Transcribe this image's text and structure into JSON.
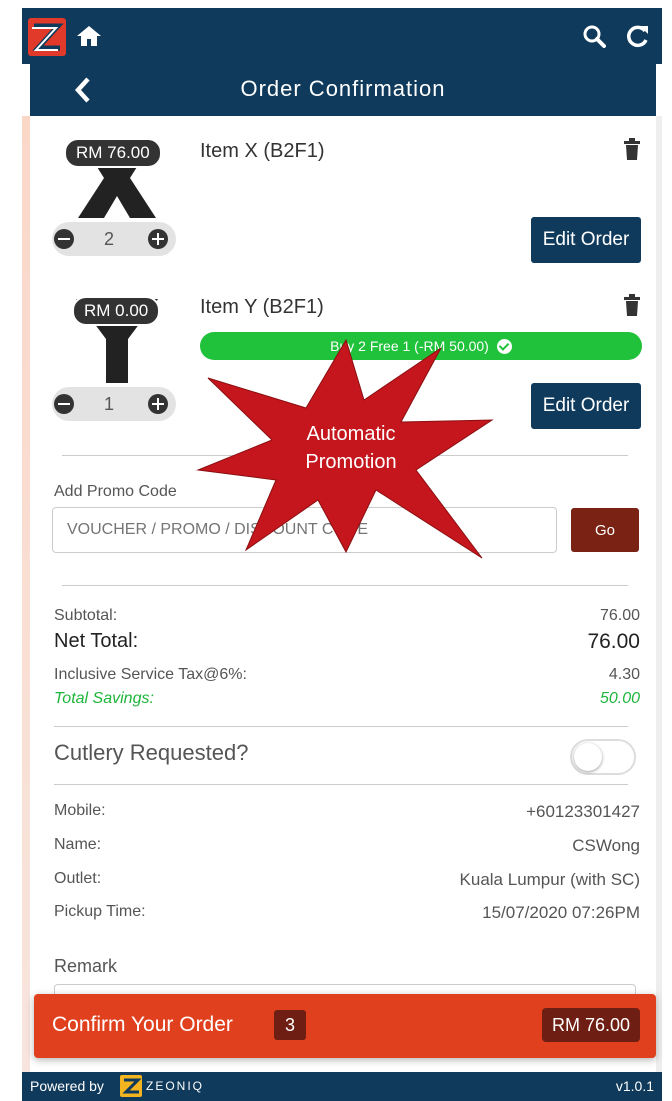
{
  "app": {
    "title": "Order Confirmation"
  },
  "items": [
    {
      "name": "Item X (B2F1)",
      "price": "RM 76.00",
      "qty": "2",
      "edit_label": "Edit Order",
      "image_letter": "X"
    },
    {
      "name": "Item Y (B2F1)",
      "price": "RM 0.00",
      "qty": "1",
      "edit_label": "Edit Order",
      "image_letter": "Y",
      "promo": "Buy 2 Free 1 (-RM 50.00)"
    }
  ],
  "promo": {
    "label": "Add Promo Code",
    "placeholder": "VOUCHER / PROMO / DISCOUNT CODE",
    "go_label": "Go"
  },
  "annotation": {
    "line1": "Automatic",
    "line2": "Promotion"
  },
  "summary": {
    "subtotal_label": "Subtotal:",
    "subtotal": "76.00",
    "net_label": "Net Total:",
    "net": "76.00",
    "tax_label": "Inclusive Service Tax@6%:",
    "tax": "4.30",
    "savings_label": "Total Savings:",
    "savings": "50.00"
  },
  "cutlery": {
    "label": "Cutlery Requested?",
    "enabled": false
  },
  "details": {
    "mobile_label": "Mobile:",
    "mobile": "+60123301427",
    "name_label": "Name:",
    "name": "CSWong",
    "outlet_label": "Outlet:",
    "outlet": "Kuala Lumpur (with SC)",
    "pickup_label": "Pickup Time:",
    "pickup": "15/07/2020 07:26PM"
  },
  "remark": {
    "label": "Remark"
  },
  "confirm": {
    "label": "Confirm Your Order",
    "count": "3",
    "total": "RM 76.00"
  },
  "footer": {
    "powered": "Powered by",
    "brand": "ZEONIQ",
    "version": "v1.0.1"
  },
  "colors": {
    "navy": "#0f3a5c",
    "accent": "#e0401e",
    "promo_green": "#1fc23a",
    "burst": "#c4161c"
  }
}
